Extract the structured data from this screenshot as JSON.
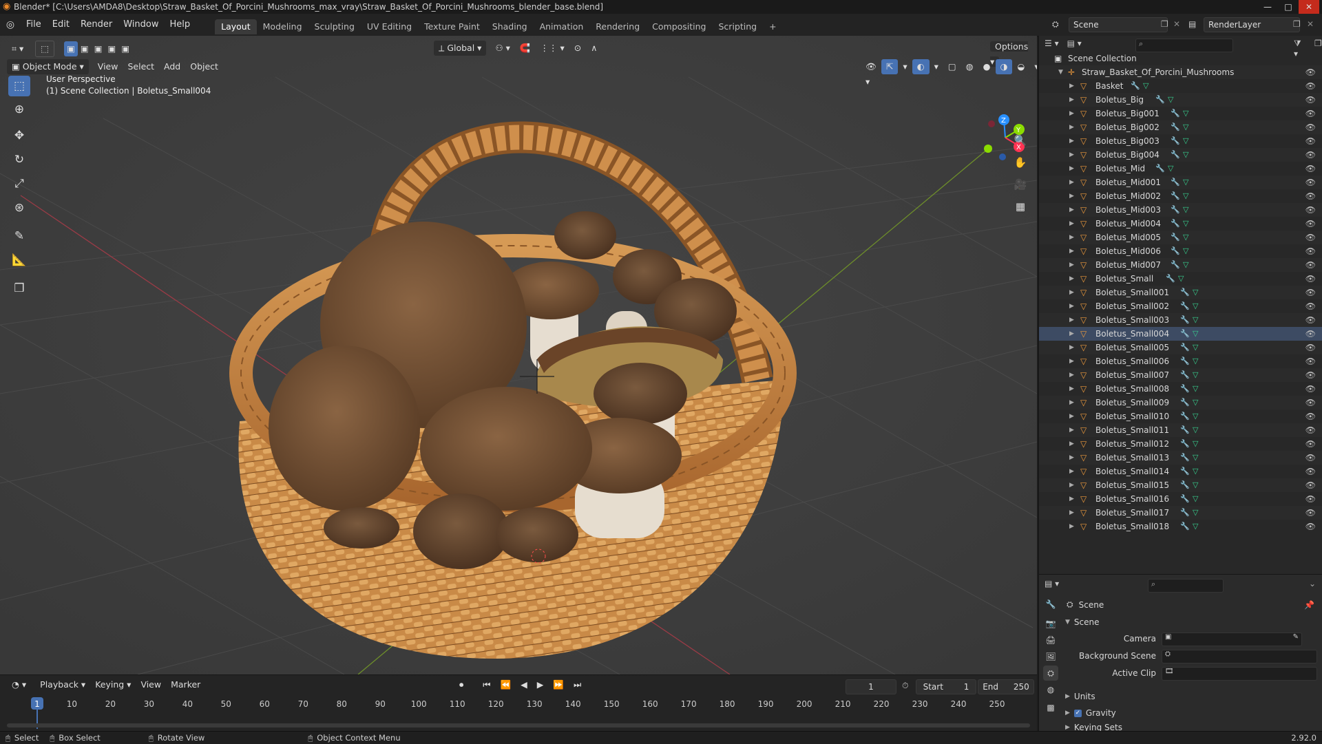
{
  "window": {
    "title": "Blender* [C:\\Users\\AMDA8\\Desktop\\Straw_Basket_Of_Porcini_Mushrooms_max_vray\\Straw_Basket_Of_Porcini_Mushrooms_blender_base.blend]",
    "minimize": "—",
    "maximize": "□",
    "close": "✕"
  },
  "menubar": {
    "items": [
      "File",
      "Edit",
      "Render",
      "Window",
      "Help"
    ],
    "workspaces": [
      "Layout",
      "Modeling",
      "Sculpting",
      "UV Editing",
      "Texture Paint",
      "Shading",
      "Animation",
      "Rendering",
      "Compositing",
      "Scripting"
    ],
    "active_workspace": "Layout",
    "add_tab": "+",
    "scene_label": "Scene",
    "view_layer_label": "RenderLayer"
  },
  "viewport": {
    "mode": "Object Mode",
    "menus": [
      "View",
      "Select",
      "Add",
      "Object"
    ],
    "transform_orientation": "Global",
    "options_label": "Options",
    "overlay_line1": "User Perspective",
    "overlay_line2": "(1) Scene Collection | Boletus_Small004",
    "gizmo": {
      "z": "Z",
      "y": "Y",
      "x": "X"
    }
  },
  "outliner": {
    "root": "Scene Collection",
    "collection": "Straw_Basket_Of_Porcini_Mushrooms",
    "selected": "Boletus_Small004",
    "objects": [
      "Basket",
      "Boletus_Big",
      "Boletus_Big001",
      "Boletus_Big002",
      "Boletus_Big003",
      "Boletus_Big004",
      "Boletus_Mid",
      "Boletus_Mid001",
      "Boletus_Mid002",
      "Boletus_Mid003",
      "Boletus_Mid004",
      "Boletus_Mid005",
      "Boletus_Mid006",
      "Boletus_Mid007",
      "Boletus_Small",
      "Boletus_Small001",
      "Boletus_Small002",
      "Boletus_Small003",
      "Boletus_Small004",
      "Boletus_Small005",
      "Boletus_Small006",
      "Boletus_Small007",
      "Boletus_Small008",
      "Boletus_Small009",
      "Boletus_Small010",
      "Boletus_Small011",
      "Boletus_Small012",
      "Boletus_Small013",
      "Boletus_Small014",
      "Boletus_Small015",
      "Boletus_Small016",
      "Boletus_Small017",
      "Boletus_Small018"
    ]
  },
  "properties": {
    "context": "Scene",
    "panel": "Scene",
    "camera_label": "Camera",
    "background_scene_label": "Background Scene",
    "active_clip_label": "Active Clip",
    "units_label": "Units",
    "gravity_label": "Gravity",
    "keying_sets_label": "Keying Sets"
  },
  "timeline": {
    "menus": [
      "Playback",
      "Keying",
      "View",
      "Marker"
    ],
    "current_frame": "1",
    "start_label": "Start",
    "start_value": "1",
    "end_label": "End",
    "end_value": "250",
    "ticks": [
      "1",
      "10",
      "20",
      "30",
      "40",
      "50",
      "60",
      "70",
      "80",
      "90",
      "100",
      "110",
      "120",
      "130",
      "140",
      "150",
      "160",
      "170",
      "180",
      "190",
      "200",
      "210",
      "220",
      "230",
      "240",
      "250"
    ]
  },
  "statusbar": {
    "select": "Select",
    "box_select": "Box Select",
    "rotate_view": "Rotate View",
    "context_menu": "Object Context Menu",
    "version": "2.92.0"
  },
  "colors": {
    "accent": "#4772b3",
    "object_icon": "#ee9a3c",
    "mesh_icon": "#37d08f",
    "axis_x": "#ff3352",
    "axis_y": "#8bdc00",
    "axis_z": "#2890ff"
  }
}
